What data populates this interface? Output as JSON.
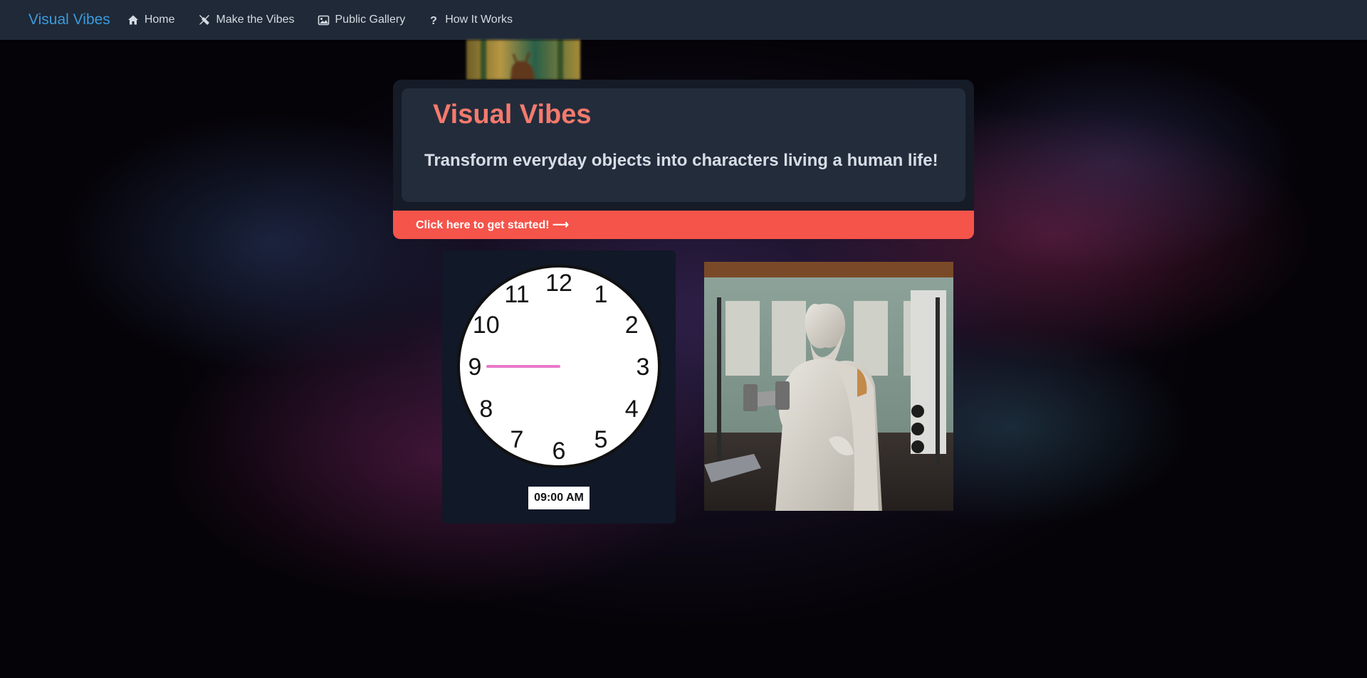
{
  "navbar": {
    "brand": "Visual Vibes",
    "items": [
      {
        "label": "Home",
        "icon": "home-icon"
      },
      {
        "label": "Make the Vibes",
        "icon": "tools-icon"
      },
      {
        "label": "Public Gallery",
        "icon": "image-icon"
      },
      {
        "label": "How It Works",
        "icon": "question-icon"
      }
    ]
  },
  "hero": {
    "title": "Visual Vibes",
    "subtitle": "Transform everyday objects into characters living a human life!",
    "cta_label": "Click here to get started! ⟶"
  },
  "clock": {
    "numbers": [
      "12",
      "1",
      "2",
      "3",
      "4",
      "5",
      "6",
      "7",
      "8",
      "9",
      "10",
      "11"
    ],
    "time_text": "09:00 AM",
    "hour": 9,
    "minute": 0
  },
  "colors": {
    "navbar_bg": "#1f2937",
    "brand": "#3b9bdc",
    "hero_title": "#f47a6d",
    "cta_bg": "#f5544a",
    "clock_hand": "#e879c9"
  },
  "gallery": {
    "thumbnail_image": "forest-deer-thumbnail",
    "main_image": "marble-statue-gym-image"
  }
}
